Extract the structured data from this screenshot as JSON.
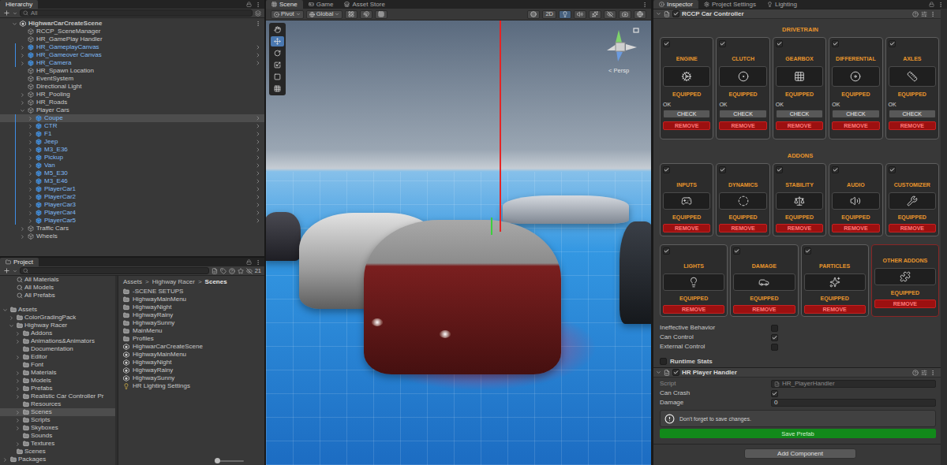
{
  "hierarchy": {
    "tab": {
      "label": "Hierarchy",
      "selected": true
    },
    "search": {
      "placeholder": "All"
    },
    "items": [
      {
        "label": "HighwarCarCreateScene",
        "depth": 0,
        "kind": "scene",
        "expandable": true,
        "expanded": true,
        "selected": false
      },
      {
        "label": "RCCP_SceneManager",
        "depth": 1,
        "kind": "object",
        "expandable": false,
        "expanded": false,
        "selected": false
      },
      {
        "label": "HR_GamePlay Handler",
        "depth": 1,
        "kind": "object",
        "expandable": false,
        "expanded": false,
        "selected": false
      },
      {
        "label": "HR_GameplayCanvas",
        "depth": 1,
        "kind": "prefab",
        "expandable": true,
        "expanded": false,
        "selected": false
      },
      {
        "label": "HR_Gameover Canvas",
        "depth": 1,
        "kind": "prefab",
        "expandable": true,
        "expanded": false,
        "selected": false
      },
      {
        "label": "HR_Camera",
        "depth": 1,
        "kind": "prefab",
        "expandable": true,
        "expanded": false,
        "selected": false
      },
      {
        "label": "HR_Spawn Location",
        "depth": 1,
        "kind": "object",
        "expandable": false,
        "expanded": false,
        "selected": false
      },
      {
        "label": "EventSystem",
        "depth": 1,
        "kind": "object",
        "expandable": false,
        "expanded": false,
        "selected": false
      },
      {
        "label": "Directional Light",
        "depth": 1,
        "kind": "object",
        "expandable": false,
        "expanded": false,
        "selected": false
      },
      {
        "label": "HR_Pooling",
        "depth": 1,
        "kind": "object",
        "expandable": true,
        "expanded": false,
        "selected": false
      },
      {
        "label": "HR_Roads",
        "depth": 1,
        "kind": "object",
        "expandable": true,
        "expanded": false,
        "selected": false
      },
      {
        "label": "Player Cars",
        "depth": 1,
        "kind": "object",
        "expandable": true,
        "expanded": true,
        "selected": false
      },
      {
        "label": "Coupe",
        "depth": 2,
        "kind": "prefab",
        "expandable": true,
        "expanded": false,
        "selected": true
      },
      {
        "label": "CTR",
        "depth": 2,
        "kind": "prefab",
        "expandable": true,
        "expanded": false,
        "selected": false
      },
      {
        "label": "F1",
        "depth": 2,
        "kind": "prefab",
        "expandable": true,
        "expanded": false,
        "selected": false
      },
      {
        "label": "Jeep",
        "depth": 2,
        "kind": "prefab",
        "expandable": true,
        "expanded": false,
        "selected": false
      },
      {
        "label": "M3_E36",
        "depth": 2,
        "kind": "prefab",
        "expandable": true,
        "expanded": false,
        "selected": false
      },
      {
        "label": "Pickup",
        "depth": 2,
        "kind": "prefab",
        "expandable": true,
        "expanded": false,
        "selected": false
      },
      {
        "label": "Van",
        "depth": 2,
        "kind": "prefab",
        "expandable": true,
        "expanded": false,
        "selected": false
      },
      {
        "label": "M5_E30",
        "depth": 2,
        "kind": "prefab",
        "expandable": true,
        "expanded": false,
        "selected": false
      },
      {
        "label": "M3_E46",
        "depth": 2,
        "kind": "prefab",
        "expandable": true,
        "expanded": false,
        "selected": false
      },
      {
        "label": "PlayerCar1",
        "depth": 2,
        "kind": "prefab",
        "expandable": true,
        "expanded": false,
        "selected": false
      },
      {
        "label": "PlayerCar2",
        "depth": 2,
        "kind": "prefab",
        "expandable": true,
        "expanded": false,
        "selected": false
      },
      {
        "label": "PlayerCar3",
        "depth": 2,
        "kind": "prefab",
        "expandable": true,
        "expanded": false,
        "selected": false
      },
      {
        "label": "PlayerCar4",
        "depth": 2,
        "kind": "prefab",
        "expandable": true,
        "expanded": false,
        "selected": false
      },
      {
        "label": "PlayerCar5",
        "depth": 2,
        "kind": "prefab",
        "expandable": true,
        "expanded": false,
        "selected": false
      },
      {
        "label": "Traffic Cars",
        "depth": 1,
        "kind": "object",
        "expandable": true,
        "expanded": false,
        "selected": false
      },
      {
        "label": "Wheels",
        "depth": 1,
        "kind": "object",
        "expandable": true,
        "expanded": false,
        "selected": false
      }
    ]
  },
  "project": {
    "tab": {
      "label": "Project",
      "selected": true
    },
    "count": "21",
    "tree": [
      {
        "label": "All Materials",
        "depth": 1,
        "kind": "search",
        "expandable": false,
        "expanded": false,
        "selected": false
      },
      {
        "label": "All Models",
        "depth": 1,
        "kind": "search",
        "expandable": false,
        "expanded": false,
        "selected": false
      },
      {
        "label": "All Prefabs",
        "depth": 1,
        "kind": "search",
        "expandable": false,
        "expanded": false,
        "selected": false
      },
      {
        "label": "Assets",
        "depth": 0,
        "kind": "folder",
        "expandable": true,
        "expanded": true,
        "selected": false
      },
      {
        "label": "ColorGradingPack",
        "depth": 1,
        "kind": "folder",
        "expandable": true,
        "expanded": false,
        "selected": false
      },
      {
        "label": "Highway Racer",
        "depth": 1,
        "kind": "folder",
        "expandable": true,
        "expanded": true,
        "selected": false
      },
      {
        "label": "Addons",
        "depth": 2,
        "kind": "folder",
        "expandable": true,
        "expanded": false,
        "selected": false
      },
      {
        "label": "Animations&Animators",
        "depth": 2,
        "kind": "folder",
        "expandable": true,
        "expanded": false,
        "selected": false
      },
      {
        "label": "Documentation",
        "depth": 2,
        "kind": "folder",
        "expandable": false,
        "expanded": false,
        "selected": false
      },
      {
        "label": "Editor",
        "depth": 2,
        "kind": "folder",
        "expandable": true,
        "expanded": false,
        "selected": false
      },
      {
        "label": "Font",
        "depth": 2,
        "kind": "folder",
        "expandable": false,
        "expanded": false,
        "selected": false
      },
      {
        "label": "Materials",
        "depth": 2,
        "kind": "folder",
        "expandable": true,
        "expanded": false,
        "selected": false
      },
      {
        "label": "Models",
        "depth": 2,
        "kind": "folder",
        "expandable": true,
        "expanded": false,
        "selected": false
      },
      {
        "label": "Prefabs",
        "depth": 2,
        "kind": "folder",
        "expandable": true,
        "expanded": false,
        "selected": false
      },
      {
        "label": "Realistic Car Controller Pr",
        "depth": 2,
        "kind": "folder",
        "expandable": true,
        "expanded": false,
        "selected": false
      },
      {
        "label": "Resources",
        "depth": 2,
        "kind": "folder",
        "expandable": false,
        "expanded": false,
        "selected": false
      },
      {
        "label": "Scenes",
        "depth": 2,
        "kind": "folder",
        "expandable": true,
        "expanded": false,
        "selected": true
      },
      {
        "label": "Scripts",
        "depth": 2,
        "kind": "folder",
        "expandable": true,
        "expanded": false,
        "selected": false
      },
      {
        "label": "Skyboxes",
        "depth": 2,
        "kind": "folder",
        "expandable": true,
        "expanded": false,
        "selected": false
      },
      {
        "label": "Sounds",
        "depth": 2,
        "kind": "folder",
        "expandable": false,
        "expanded": false,
        "selected": false
      },
      {
        "label": "Textures",
        "depth": 2,
        "kind": "folder",
        "expandable": true,
        "expanded": false,
        "selected": false
      },
      {
        "label": "Scenes",
        "depth": 1,
        "kind": "folder",
        "expandable": false,
        "expanded": false,
        "selected": false
      },
      {
        "label": "Packages",
        "depth": 0,
        "kind": "folder",
        "expandable": true,
        "expanded": false,
        "selected": false
      }
    ],
    "breadcrumb": [
      "Assets",
      "Highway Racer",
      "Scenes"
    ],
    "separator": ">",
    "files": [
      {
        "label": "-SCENE SETUPS",
        "kind": "folder"
      },
      {
        "label": "HighwayMainMenu",
        "kind": "folder"
      },
      {
        "label": "HighwayNight",
        "kind": "folder"
      },
      {
        "label": "HighwayRainy",
        "kind": "folder"
      },
      {
        "label": "HighwaySunny",
        "kind": "folder"
      },
      {
        "label": "MainMenu",
        "kind": "folder"
      },
      {
        "label": "Profiles",
        "kind": "folder"
      },
      {
        "label": "HighwarCarCreateScene",
        "kind": "scene"
      },
      {
        "label": "HighwayMainMenu",
        "kind": "scene"
      },
      {
        "label": "HighwayNight",
        "kind": "scene"
      },
      {
        "label": "HighwayRainy",
        "kind": "scene"
      },
      {
        "label": "HighwaySunny",
        "kind": "scene"
      },
      {
        "label": "HR Lighting Settings",
        "kind": "settings"
      }
    ],
    "zoom_level": 0
  },
  "scene": {
    "tabs": [
      {
        "label": "Scene",
        "selected": true
      },
      {
        "label": "Game",
        "selected": false
      },
      {
        "label": "Asset Store",
        "selected": false
      }
    ],
    "pivot": "Pivot",
    "space": "Global",
    "mode_2d": "2D",
    "mode_2d_on": false,
    "tools": [
      {
        "kind": "hand",
        "selected": false
      },
      {
        "kind": "move",
        "selected": true
      },
      {
        "kind": "rotate",
        "selected": false
      },
      {
        "kind": "scale",
        "selected": false
      },
      {
        "kind": "rect",
        "selected": false
      },
      {
        "kind": "transform",
        "selected": false
      }
    ],
    "projection": "< Persp"
  },
  "inspector": {
    "tabs": [
      {
        "label": "Inspector",
        "selected": true
      },
      {
        "label": "Project Settings",
        "selected": false
      },
      {
        "label": "Lighting",
        "selected": false
      }
    ],
    "car_controller": {
      "title": "RCCP Car Controller",
      "enabled": true,
      "expanded": true,
      "sections": [
        {
          "title": "DRIVETRAIN",
          "cards": [
            {
              "label": "ENGINE",
              "checked": true,
              "status": "EQUIPPED",
              "ok": "OK",
              "check": "CHECK",
              "remove": "REMOVE",
              "highlighted": false
            },
            {
              "label": "CLUTCH",
              "checked": true,
              "status": "EQUIPPED",
              "ok": "OK",
              "check": "CHECK",
              "remove": "REMOVE",
              "highlighted": false
            },
            {
              "label": "GEARBOX",
              "checked": true,
              "status": "EQUIPPED",
              "ok": "OK",
              "check": "CHECK",
              "remove": "REMOVE",
              "highlighted": false
            },
            {
              "label": "DIFFERENTIAL",
              "checked": true,
              "status": "EQUIPPED",
              "ok": "OK",
              "check": "CHECK",
              "remove": "REMOVE",
              "highlighted": false
            },
            {
              "label": "AXLES",
              "checked": true,
              "status": "EQUIPPED",
              "ok": "OK",
              "check": "CHECK",
              "remove": "REMOVE",
              "highlighted": false
            }
          ]
        },
        {
          "title": "ADDONS",
          "cards": [
            {
              "label": "INPUTS",
              "checked": true,
              "status": "EQUIPPED",
              "remove": "REMOVE",
              "highlighted": false
            },
            {
              "label": "DYNAMICS",
              "checked": true,
              "status": "EQUIPPED",
              "remove": "REMOVE",
              "highlighted": false
            },
            {
              "label": "STABILITY",
              "checked": true,
              "status": "EQUIPPED",
              "remove": "REMOVE",
              "highlighted": false
            },
            {
              "label": "AUDIO",
              "checked": true,
              "status": "EQUIPPED",
              "remove": "REMOVE",
              "highlighted": false
            },
            {
              "label": "CUSTOMIZER",
              "checked": true,
              "status": "EQUIPPED",
              "remove": "REMOVE",
              "highlighted": false
            }
          ]
        },
        {
          "cards": [
            {
              "label": "LIGHTS",
              "checked": true,
              "status": "EQUIPPED",
              "remove": "REMOVE",
              "highlighted": false
            },
            {
              "label": "DAMAGE",
              "checked": true,
              "status": "EQUIPPED",
              "remove": "REMOVE",
              "highlighted": false
            },
            {
              "label": "PARTICLES",
              "checked": true,
              "status": "EQUIPPED",
              "remove": "REMOVE",
              "highlighted": false
            },
            {
              "label": "OTHER ADDONS",
              "status": "EQUIPPED",
              "remove": "REMOVE",
              "highlighted": true
            }
          ]
        }
      ],
      "options": [
        {
          "label": "Ineffective Behavior",
          "checked": false
        },
        {
          "label": "Can Control",
          "checked": true
        },
        {
          "label": "External Control",
          "checked": false
        }
      ],
      "runtime_stats": {
        "label": "Runtime Stats",
        "checked": false
      }
    },
    "player_handler": {
      "title": "HR Player Handler",
      "enabled": true,
      "expanded": true,
      "fields": [
        {
          "kind": "object",
          "label": "Script",
          "value": "HR_PlayerHandler",
          "disabled": true
        },
        {
          "kind": "toggle",
          "label": "Can Crash",
          "checked": true,
          "disabled": false
        },
        {
          "kind": "number",
          "label": "Damage",
          "value": "0",
          "disabled": false
        }
      ],
      "help": "Don't forget to save changes.",
      "save_button": "Save Prefab"
    },
    "add_component": "Add Component"
  }
}
